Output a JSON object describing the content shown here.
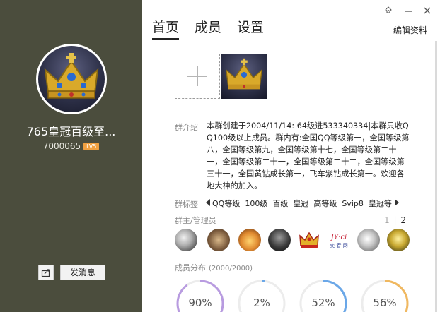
{
  "group": {
    "name": "765皇冠百级至...",
    "id": "7000065",
    "level": "LV5"
  },
  "actions": {
    "send_message": "发消息",
    "share_icon": "share-icon"
  },
  "tabs": [
    {
      "label": "首页",
      "active": true
    },
    {
      "label": "成员",
      "active": false
    },
    {
      "label": "设置",
      "active": false
    }
  ],
  "window_buttons": [
    "pin-icon",
    "minimize-icon",
    "close-icon"
  ],
  "edit_label": "编辑资料",
  "intro": {
    "label": "群介绍",
    "text": "本群创建于2004/11/14:  64级进533340334|本群只收QQ100级以上成员。群内有:全国QQ等级第一，全国等级第八，全国等级第九，全国等级第十七，全国等级第二十一，全国等级第二十一，全国等级第二十二，全国等级第三十一，全国黄钻成长第一，飞车紫钻成长第一。欢迎各地大神的加入。"
  },
  "tags": {
    "label": "群标签",
    "items": [
      "QQ等级",
      "100级",
      "百级",
      "皇冠",
      "高等级",
      "Svip8",
      "皇冠等"
    ]
  },
  "admins": {
    "label": "群主/管理员",
    "pager": {
      "page1": "1",
      "page2": "2"
    }
  },
  "distribution": {
    "label": "成员分布",
    "count": "(2000/2000)",
    "rings": [
      {
        "value": "90%",
        "fraction": 0.9,
        "color": "#b89be0"
      },
      {
        "value": "2%",
        "fraction": 0.02,
        "color": "#6aa7e8"
      },
      {
        "value": "52%",
        "fraction": 0.52,
        "color": "#6aa7e8"
      },
      {
        "value": "56%",
        "fraction": 0.56,
        "color": "#f0b860"
      }
    ]
  }
}
